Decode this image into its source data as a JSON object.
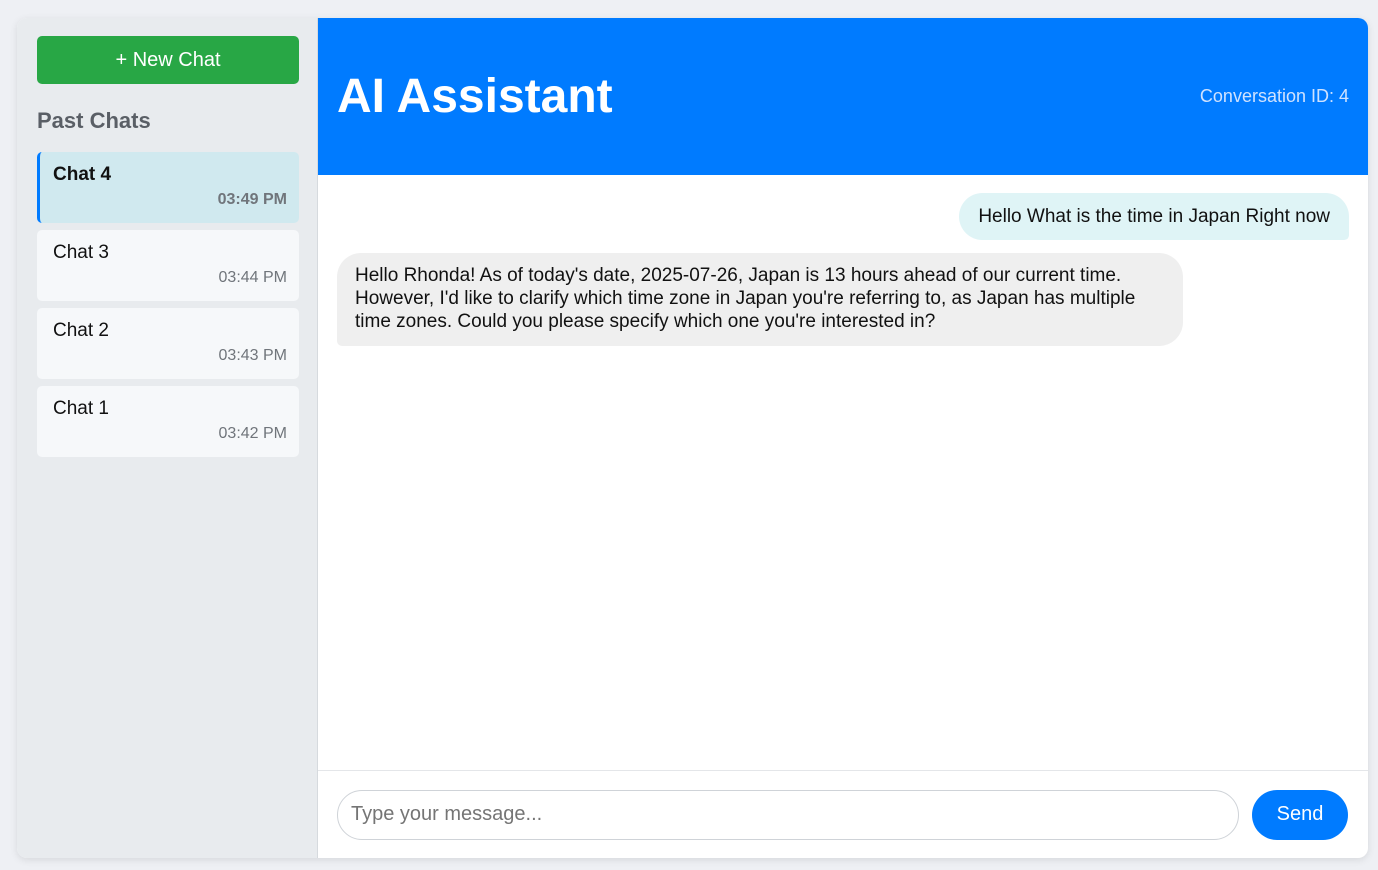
{
  "sidebar": {
    "new_chat_label": "+ New Chat",
    "past_heading": "Past Chats",
    "chats": [
      {
        "name": "Chat 4",
        "time": "03:49 PM"
      },
      {
        "name": "Chat 3",
        "time": "03:44 PM"
      },
      {
        "name": "Chat 2",
        "time": "03:43 PM"
      },
      {
        "name": "Chat 1",
        "time": "03:42 PM"
      }
    ]
  },
  "header": {
    "title": "AI Assistant",
    "conversation_id": "Conversation ID: 4"
  },
  "messages": [
    {
      "role": "user",
      "text": "Hello What is the time in Japan Right now"
    },
    {
      "role": "assistant",
      "text": "Hello Rhonda! As of today's date, 2025-07-26, Japan is 13 hours ahead of our current time. However, I'd like to clarify which time zone in Japan you're referring to, as Japan has multiple time zones. Could you please specify which one you're interested in?"
    }
  ],
  "composer": {
    "placeholder": "Type your message...",
    "value": "",
    "send_label": "Send"
  },
  "colors": {
    "primary": "#007bff",
    "new_chat": "#28a745",
    "active_chat_bg": "#d0e9ef",
    "user_bubble": "#dff4f6",
    "bot_bubble": "#efefef"
  }
}
